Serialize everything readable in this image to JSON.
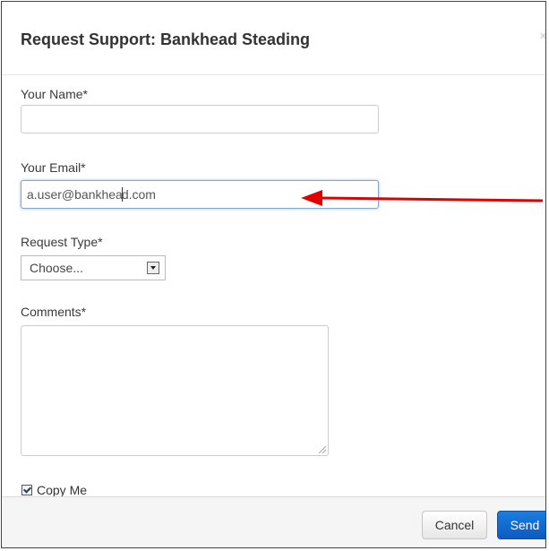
{
  "dialog": {
    "title": "Request Support: Bankhead Steading",
    "close_glyph": "×"
  },
  "form": {
    "name": {
      "label": "Your Name*",
      "value": ""
    },
    "email": {
      "label": "Your Email*",
      "value_before_caret": "a.user@bankhea",
      "value_after_caret": "d.com"
    },
    "request_type": {
      "label": "Request Type*",
      "selected": "Choose..."
    },
    "comments": {
      "label": "Comments*",
      "value": ""
    },
    "copy_me": {
      "label": "Copy Me",
      "checked": true
    }
  },
  "footer": {
    "cancel_label": "Cancel",
    "send_label": "Send"
  },
  "annotation": {
    "color": "#e00000",
    "points_to": "email-field"
  },
  "colors": {
    "send_button": "#1470d2",
    "frame_border": "#1c4a8a",
    "focus_border": "#7fa7d8"
  }
}
